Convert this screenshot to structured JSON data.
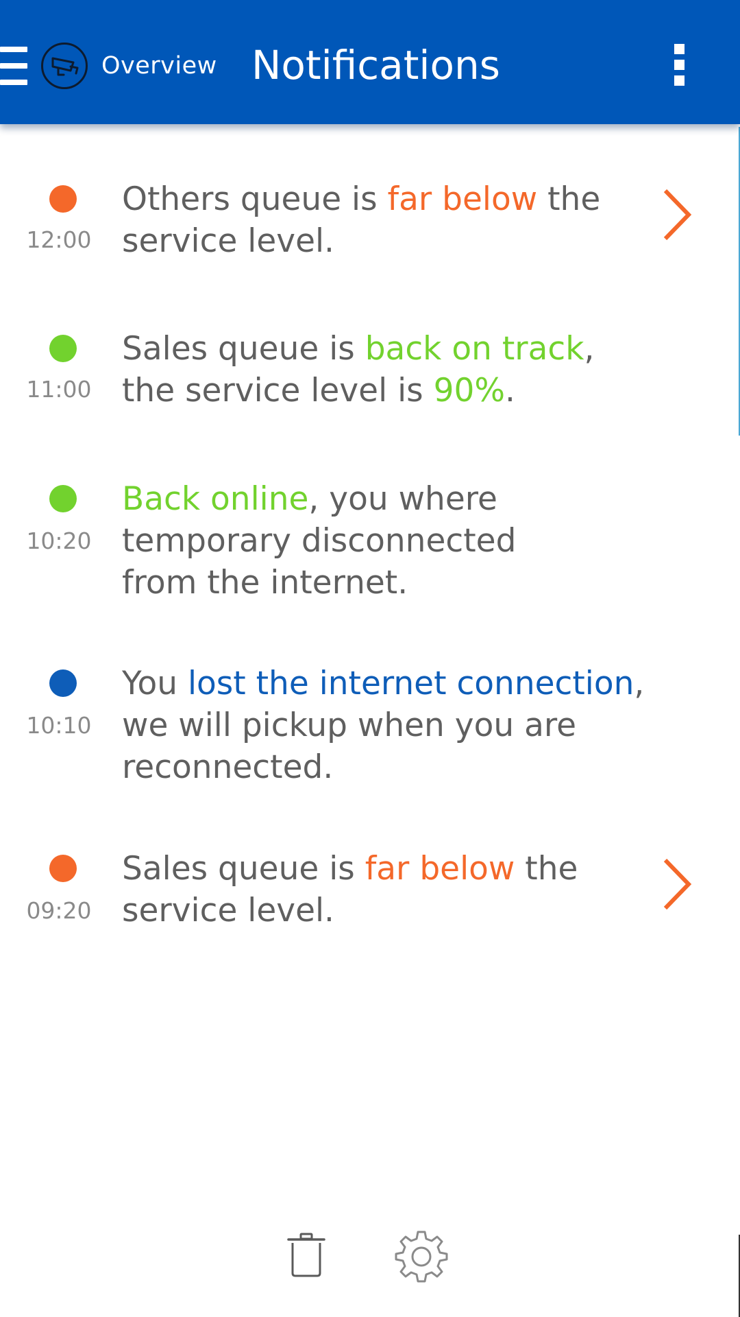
{
  "header": {
    "overview_label": "Overview",
    "title": "Notifications",
    "background": "#0057b8",
    "icons": [
      "menu-icon",
      "queue-camera-logo-icon",
      "overflow-menu-icon"
    ]
  },
  "notifications": [
    {
      "time": "12:00",
      "status": "warning",
      "dot_color": "#f4682a",
      "parts": [
        "Others queue is ",
        "far below",
        " the service level."
      ],
      "has_chevron": true
    },
    {
      "time": "11:00",
      "status": "ok",
      "dot_color": "#72d22e",
      "parts": [
        "Sales queue is ",
        "back on track",
        ", the service level is ",
        "90%",
        "."
      ],
      "has_chevron": false
    },
    {
      "time": "10:20",
      "status": "ok",
      "dot_color": "#72d22e",
      "parts": [
        "Back online",
        ", you where temporary disconnected from the internet."
      ],
      "has_chevron": false
    },
    {
      "time": "10:10",
      "status": "info",
      "dot_color": "#0e5db8",
      "parts": [
        "You ",
        "lost the internet connection",
        ", we will pickup when you are reconnected."
      ],
      "has_chevron": false
    },
    {
      "time": "09:20",
      "status": "warning",
      "dot_color": "#f4682a",
      "parts": [
        "Sales queue is ",
        "far below",
        " the service level."
      ],
      "has_chevron": true
    }
  ],
  "toolbar": {
    "icons": [
      "trash-icon",
      "settings-gear-icon"
    ]
  },
  "colors": {
    "warning": "#f4682a",
    "ok": "#72d22e",
    "info": "#0e5db8",
    "text": "#5f5f5f",
    "time": "#8a8a8a"
  }
}
